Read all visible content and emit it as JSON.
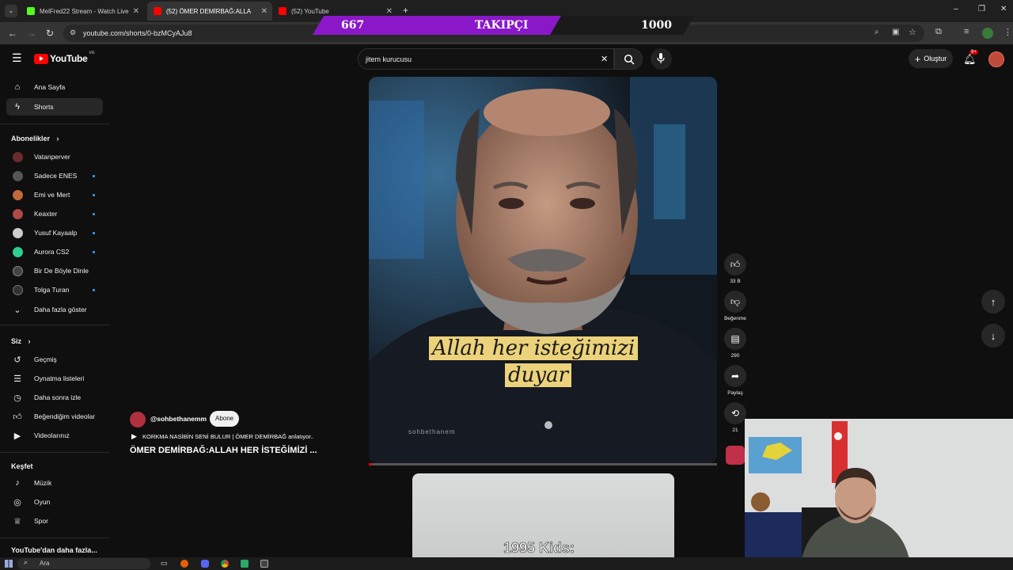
{
  "browser": {
    "tabs": [
      {
        "title": "MelFred22 Stream - Watch Live",
        "favicon_color": "#53fc18"
      },
      {
        "title": "(52) ÖMER DEMİRBAĞ:ALLA",
        "favicon_color": "#ff0000"
      },
      {
        "title": "(52) YouTube",
        "favicon_color": "#ff0000"
      }
    ],
    "url": "youtube.com/shorts/0-bzMCyAJu8"
  },
  "overlay": {
    "current": "667",
    "label": "TAKIPÇI",
    "goal": "1000"
  },
  "header": {
    "logo": "YouTube",
    "region": "ME",
    "search_value": "jitem kurucusu",
    "create_label": "Oluştur",
    "notif_badge": "9+"
  },
  "sidebar": {
    "main": [
      {
        "label": "Ana Sayfa",
        "icon": "home-icon"
      },
      {
        "label": "Shorts",
        "icon": "shorts-icon"
      }
    ],
    "subs_title": "Abonelikler",
    "subs": [
      {
        "label": "Vatanperver",
        "color": "#6b2b2b",
        "new": false
      },
      {
        "label": "Sadece ENES",
        "color": "#555555",
        "new": true
      },
      {
        "label": "Emi ve Mert",
        "color": "#c06a3a",
        "new": true
      },
      {
        "label": "Keaxter",
        "color": "#b04848",
        "new": true
      },
      {
        "label": "Yusuf Kayaalp",
        "color": "#cccccc",
        "new": true
      },
      {
        "label": "Aurora CS2",
        "color": "#2ed090",
        "new": true
      },
      {
        "label": "Bir De Böyle Dinle",
        "color": "#444444",
        "new": false
      },
      {
        "label": "Tolga Turan",
        "color": "#333333",
        "new": true
      }
    ],
    "show_more": "Daha fazla göster",
    "you_title": "Siz",
    "you": [
      {
        "label": "Geçmiş",
        "icon": "history-icon"
      },
      {
        "label": "Oynatma listeleri",
        "icon": "playlist-icon"
      },
      {
        "label": "Daha sonra izle",
        "icon": "clock-icon"
      },
      {
        "label": "Beğendiğim videolar",
        "icon": "thumb-up-icon"
      },
      {
        "label": "Videolarınız",
        "icon": "video-icon"
      }
    ],
    "explore_title": "Keşfet",
    "explore": [
      {
        "label": "Müzik",
        "icon": "music-icon"
      },
      {
        "label": "Oyun",
        "icon": "game-icon"
      },
      {
        "label": "Spor",
        "icon": "trophy-icon"
      }
    ],
    "more_title": "YouTube'dan daha fazla..."
  },
  "video": {
    "caption_line1": "Allah her isteğimizi",
    "caption_line2": "duyar",
    "watermark": "sohbethanem",
    "channel": "@sohbethanemm",
    "subscribe": "Abone ol",
    "related": "KORKMA NASİBİN SENİ BULUR | ÖMER DEMİRBAĞ anlatıyor..",
    "title": "ÖMER DEMİRBAĞ:ALLAH HER İSTEĞİMİZİ ...",
    "progress": 0.01,
    "next_caption": "1995 Kids:"
  },
  "actions": {
    "likes": "33 B",
    "dislike": "Beğenme",
    "comments": "290",
    "share": "Paylaş",
    "remix": "21"
  },
  "taskbar": {
    "search": "Ara"
  }
}
